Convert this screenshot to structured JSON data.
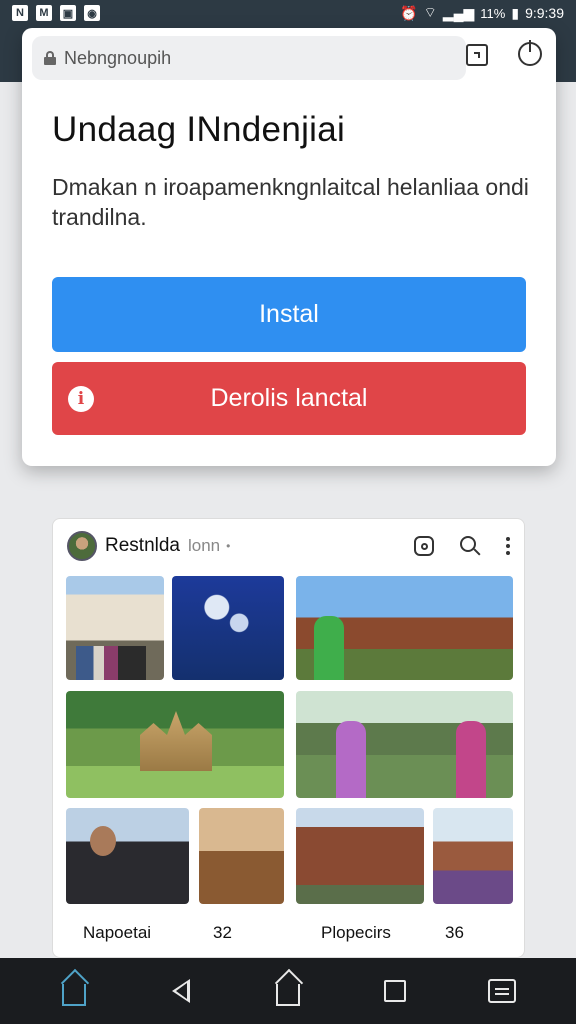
{
  "status_bar": {
    "battery": "11%",
    "time": "9:9:39"
  },
  "browser": {
    "url": "Nebngnoupih"
  },
  "install_dialog": {
    "title": "Undaag INndenjiai",
    "description": "Dmakan n iroapamenkngnlaitcal helanliaa ondi trandilna.",
    "install_label": "Instal",
    "cancel_label": "Derolis lanctal",
    "colors": {
      "install": "#2f8ff1",
      "cancel": "#e04548"
    }
  },
  "feed": {
    "account_name": "Restnlda",
    "account_sub": "lonn",
    "captions": [
      {
        "text": "Napoetai"
      },
      {
        "text": "32"
      },
      {
        "text": "Plopecirs"
      },
      {
        "text": "36"
      }
    ]
  },
  "nav_bar": {
    "icons": [
      "home-outline-icon",
      "back-icon",
      "home-icon",
      "recents-icon",
      "menu-icon"
    ]
  }
}
